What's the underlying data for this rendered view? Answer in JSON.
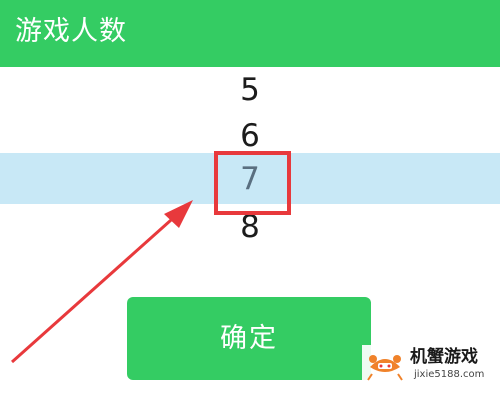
{
  "header": {
    "title": "游戏人数"
  },
  "picker": {
    "items": [
      "5",
      "6",
      "7",
      "8"
    ],
    "selected_value": "7"
  },
  "confirm_button": {
    "label": "确定"
  },
  "watermark": {
    "brand": "机蟹游戏",
    "url": "jixie5188.com"
  },
  "colors": {
    "accent_green": "#34cc63",
    "selection_band": "#c8e8f6",
    "annotation_red": "#e8393c"
  }
}
